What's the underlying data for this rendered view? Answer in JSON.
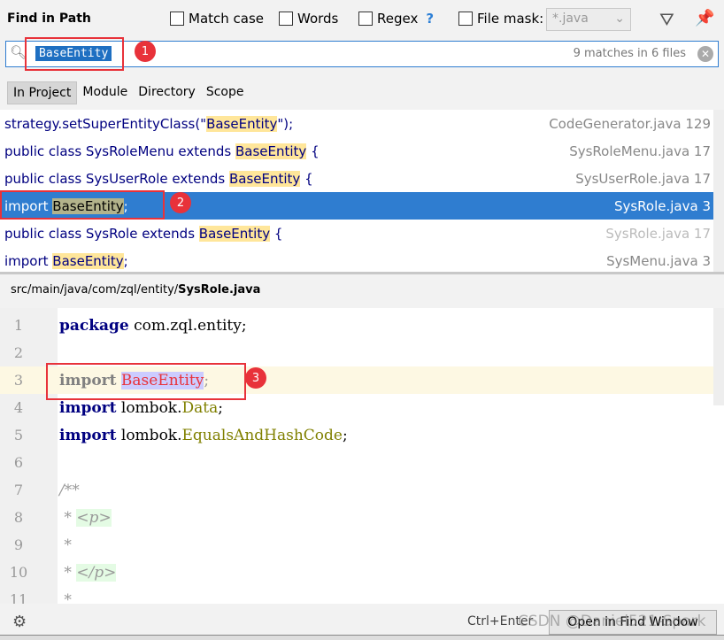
{
  "header": {
    "title": "Find in Path",
    "options": [
      {
        "label": "Match case",
        "checked": false
      },
      {
        "label": "Words",
        "checked": false
      },
      {
        "label": "Regex",
        "checked": false
      }
    ],
    "regex_help": "?",
    "file_mask_label": "File mask:",
    "file_mask_checked": false,
    "file_mask_value": "*.java"
  },
  "search": {
    "value": "BaseEntity",
    "match_count": "9 matches in 6 files"
  },
  "scopes": [
    {
      "label": "In Project",
      "active": true
    },
    {
      "label": "Module"
    },
    {
      "label": "Directory"
    },
    {
      "label": "Scope"
    }
  ],
  "results": [
    {
      "pre": "strategy.setSuperEntityClass(\"",
      "match": "BaseEntity",
      "post": "\");",
      "file": "CodeGenerator.java 129"
    },
    {
      "pre": "public class SysRoleMenu extends ",
      "match": "BaseEntity",
      "post": " {",
      "file": "SysRoleMenu.java 17"
    },
    {
      "pre": "public class SysUserRole extends ",
      "match": "BaseEntity",
      "post": " {",
      "file": "SysUserRole.java 17"
    },
    {
      "pre": "import ",
      "match": "BaseEntity",
      "post": ";",
      "file": "SysRole.java 3",
      "selected": true
    },
    {
      "pre": "public class SysRole extends ",
      "match": "BaseEntity",
      "post": " {",
      "file": "SysRole.java 17"
    },
    {
      "pre": "import ",
      "match": "BaseEntity",
      "post": ";",
      "file": "SysMenu.java 3"
    }
  ],
  "preview": {
    "path_dir": "src/main/java/com/zql/entity/",
    "path_file": "SysRole.java",
    "lines": [
      "1",
      "2",
      "3",
      "4",
      "5",
      "6",
      "7",
      "8",
      "9",
      "10",
      "11"
    ],
    "code": {
      "l1kw": "package",
      "l1": " com.zql.entity;",
      "imp": "import",
      "l3match": "BaseEntity",
      "semi": ";",
      "l4pkg": " lombok.",
      "l4cls": "Data",
      "l5cls": "EqualsAndHashCode",
      "l7": "/**",
      "star": " * ",
      "ptag": "<p>",
      "pclose": "</p>",
      "star2": " *"
    }
  },
  "annotations": [
    "1",
    "2",
    "3"
  ],
  "footer": {
    "shortcut": "Ctrl+Enter",
    "open_button": "Open in Find Window",
    "watermark": "CSDN @Daniel521-Spark"
  },
  "colors": {
    "accent": "#2f7dd0",
    "highlight": "#ffe69a",
    "annotation": "#e8323a"
  }
}
